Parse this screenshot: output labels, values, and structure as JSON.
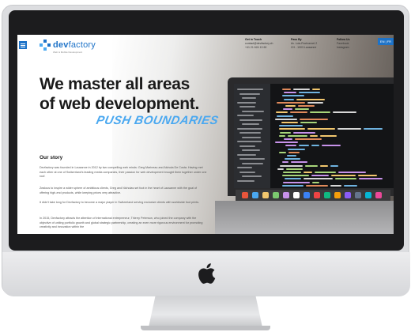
{
  "site": {
    "logo_name_prefix": "dev",
    "logo_name_suffix": "factory",
    "logo_subtitle": "Web & Mobile Development",
    "header": {
      "columns": [
        {
          "heading": "Get in Touch",
          "lines": [
            "contact@devfactory.ch",
            "+41 21 624 13 60"
          ]
        },
        {
          "heading": "Pass By",
          "lines": [
            "Av. Lois-Ruchonnet 2",
            "CH - 1003 Lausanne"
          ]
        },
        {
          "heading": "Follow Us",
          "lines": [
            "Facebook",
            "Instagram"
          ]
        }
      ],
      "language": "EN | FR"
    },
    "hero": {
      "headline_line1": "We master all areas",
      "headline_line2": "of web development.",
      "tagline": "PUSH BOUNDARIES"
    },
    "story": {
      "title": "Our story",
      "paragraphs": [
        "Devfactory was founded in Lausanne in 2012 by two compelling web minds: Greg Marineau and Akinola De Costa. Having met each other at one of Switzerland's leading media companies, their passion for web development brought them together under one roof.",
        "Zealous to inspire a wider sphere of ambitious clients, Greg and Nicholas set foot in the heart of Lausanne with the goal of offering high-end products, while keeping prices very attractive.",
        "It didn't take long for Devfactory to become a major player in Switzerland serving exclusive clients with worldwide foot prints.",
        "In 2015, Devfactory attracts the attention of international entrepreneur, Thierry Peterson, who joined the company with the objective of uniting portfolio growth and global strategic partnership, creating an even more rigorous environment for promoting creativity and innovation within the"
      ]
    }
  },
  "colors": {
    "brand_blue": "#1e73c8",
    "tagline_blue": "#4aa8f0",
    "headline": "#1a1a1a"
  },
  "icons": {
    "menu": "hamburger-icon",
    "device_logo": "apple-logo-icon"
  }
}
